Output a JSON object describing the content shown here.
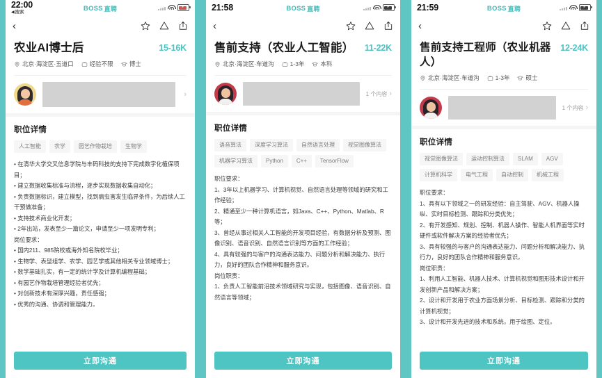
{
  "theme": {
    "teal": "#5FC6C4",
    "accent": "#4EC3C1",
    "brand_text": "BOSS",
    "brand_cn": "直聘"
  },
  "panels": [
    {
      "status": {
        "time": "22:00",
        "back_label": "搜索",
        "brand": "BOSS",
        "brand_cn": "直聘",
        "battery": "charging"
      },
      "nav": {
        "back": "‹",
        "favorite": "star-icon",
        "report": "warning-icon",
        "share": "share-icon"
      },
      "job": {
        "title": "农业AI博士后",
        "salary": "15-16K",
        "location": "北京·海淀区·五道口",
        "experience": "经验不限",
        "education": "博士"
      },
      "boss_card": {
        "count_label": ""
      },
      "details": {
        "section_title": "职位详情",
        "tags": [
          "人工智能",
          "农学",
          "园艺作物栽培",
          "生物学"
        ],
        "paragraphs": [
          "• 在清华大学交叉信息学院与丰码科技的支持下完成数字化植保项目；",
          "• 建立数据收集标准与流程，逐步实现数据收集自动化；",
          "• 负责数据标识，建立模型，找到病虫害发生临界条件，为后续人工干预做准备；",
          "• 支持技术商业化开发；",
          "• 2年出站，发表至少一篇论文，申请至少一项发明专利；",
          "岗位要求：",
          "• 国内211、985院校或海外知名院校毕业；",
          "• 生物学、表型组学、农学、园艺学或其他相关专业领域博士；",
          "• 数学基础扎实，有一定的统计学及计算机编程基础；",
          "• 有园艺作物栽培管理经验者优先；",
          "• 对创新技术有深厚兴趣，责任感强；",
          "• 优秀的沟通、协调和管理能力。"
        ]
      },
      "cta": "立即沟通"
    },
    {
      "status": {
        "time": "21:58",
        "back_label": "",
        "brand": "BOSS",
        "brand_cn": "直聘",
        "battery": "charging"
      },
      "nav": {
        "back": "‹",
        "favorite": "star-icon",
        "report": "warning-icon",
        "share": "share-icon"
      },
      "job": {
        "title": "售前支持（农业人工智能）",
        "salary": "11-22K",
        "location": "北京·海淀区·车道沟",
        "experience": "1-3年",
        "education": "本科"
      },
      "boss_card": {
        "count_label": "1 个内容"
      },
      "details": {
        "section_title": "职位详情",
        "tags": [
          "语音算法",
          "深度学习算法",
          "自然语言处理",
          "视觉图像算法",
          "机器学习算法",
          "Python",
          "C++",
          "TensorFlow"
        ],
        "paragraphs": [
          "职位要求：",
          "1、3年以上机器学习、计算机视觉、自然语言处理等领域的研究和工作经验；",
          "2、精通至少一种计算机语言，如Java、C++、Python、Matlab、R等；",
          "3、曾经从事过相关人工智能的开发项目经验，有数据分析及预测、图像识别、语音识别、自然语言识别等方面的工作经验；",
          "4、具有较强的与客户的沟通表达能力、问题分析和解决能力、执行力，良好的团队合作精神和服务意识。",
          "岗位职责：",
          "1、负责人工智能前沿技术领域研究与实现，包括图像、语音识别、自然语言等领域；"
        ]
      },
      "cta": "立即沟通"
    },
    {
      "status": {
        "time": "21:59",
        "back_label": "",
        "brand": "BOSS",
        "brand_cn": "直聘",
        "battery": "charging"
      },
      "nav": {
        "back": "‹",
        "favorite": "star-icon",
        "report": "warning-icon",
        "share": "share-icon"
      },
      "job": {
        "title": "售前支持工程师（农业机器人）",
        "salary": "12-24K",
        "location": "北京·海淀区·车道沟",
        "experience": "1-3年",
        "education": "硕士"
      },
      "boss_card": {
        "count_label": "1 个内容"
      },
      "details": {
        "section_title": "职位详情",
        "tags": [
          "视觉图像算法",
          "运动控制算法",
          "SLAM",
          "AGV",
          "计算机科学",
          "电气工程",
          "自动控制",
          "机械工程"
        ],
        "paragraphs": [
          "职位要求：",
          "1、具有以下领域之一的研发经验：自主驾驶、AGV、机器人操纵、实时目标检测、跟踪和分类优先；",
          "2、有开发感知、规划、控制、机器人操作、智能人机界面等实时硬件或软件解决方案的经验者优先；",
          "3、具有较强的与客户的沟通表达能力、问题分析和解决能力、执行力，良好的团队合作精神和服务意识。",
          "岗位职责：",
          "1、利用人工智能、机器人技术、计算机视觉和图形技术设计和开发创新产品和解决方案；",
          "2、设计和开发用于农业方面场景分析、目标检测、跟踪和分类的计算机视觉；",
          "3、设计和开发先进的技术和系统，用于绘图、定位。"
        ]
      },
      "cta": "立即沟通"
    }
  ]
}
